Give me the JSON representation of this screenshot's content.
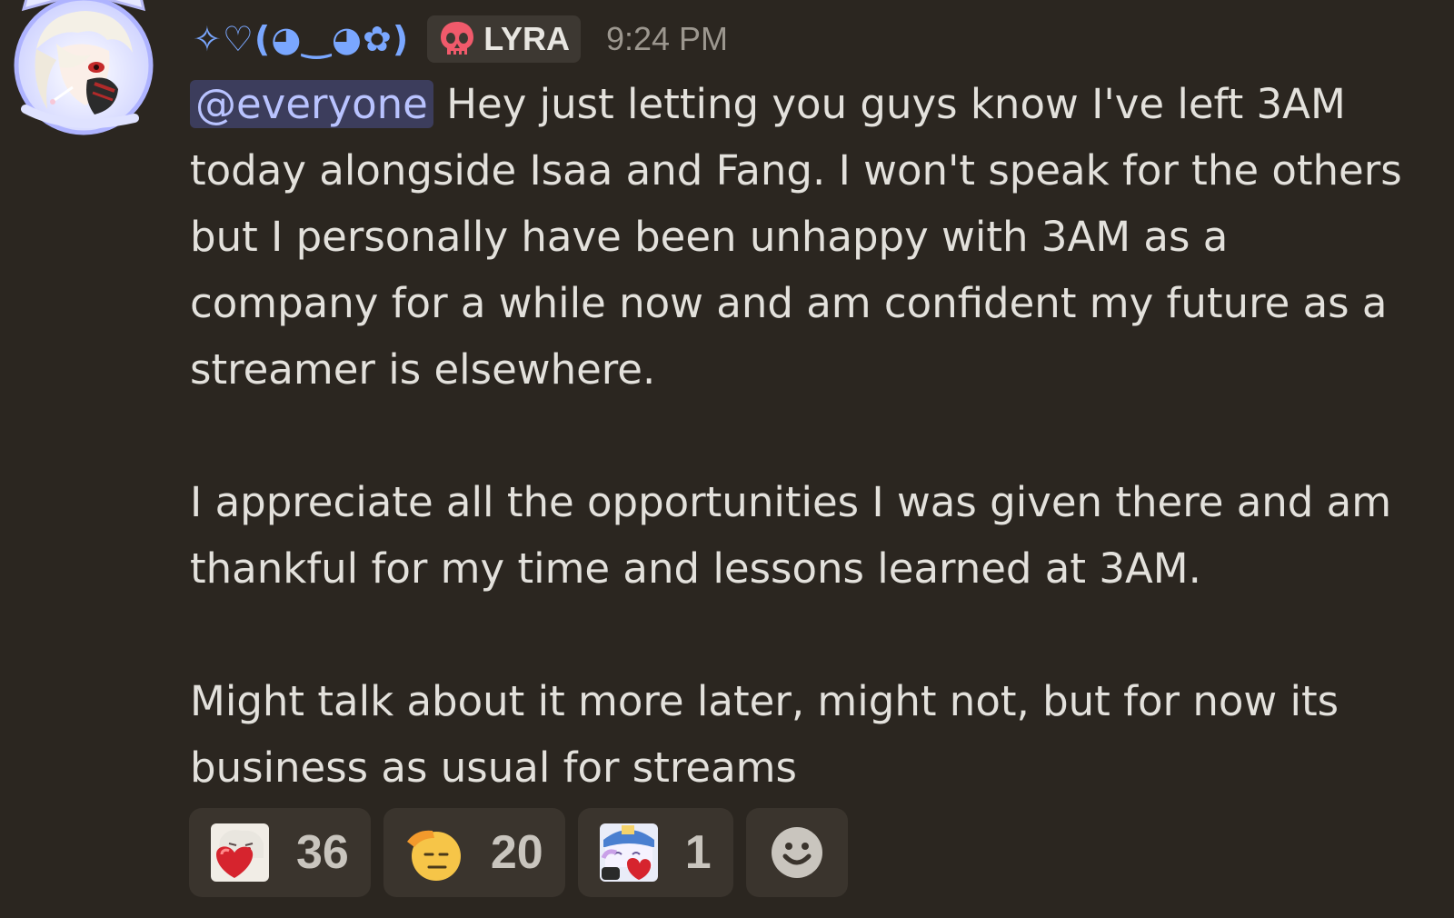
{
  "author": {
    "display_name": "✧♡(◕‿◕✿)",
    "tag_label": "LYRA",
    "timestamp": "9:24 PM",
    "colors": {
      "name": "#7aa7ff",
      "tag_icon": "#f05a6b"
    }
  },
  "message": {
    "mention": "@everyone",
    "paragraphs": [
      " Hey just letting you guys know I've left 3AM today alongside Isaa and Fang. I won't speak for the others but I personally have been unhappy with 3AM as a company for a while now and am confident my future as a streamer is elsewhere.",
      "I appreciate all the opportunities I was given there and am thankful for my time and lessons learned at 3AM.",
      "Might talk about it more later, might not, but for now its business as usual for streams"
    ]
  },
  "reactions": [
    {
      "emoji": "heart-hug-emote-icon",
      "count": "36"
    },
    {
      "emoji": "saluting-face-icon",
      "count": "20"
    },
    {
      "emoji": "anime-heart-emote-icon",
      "count": "1"
    }
  ],
  "add_reaction_icon": "smiley-add-reaction-icon"
}
